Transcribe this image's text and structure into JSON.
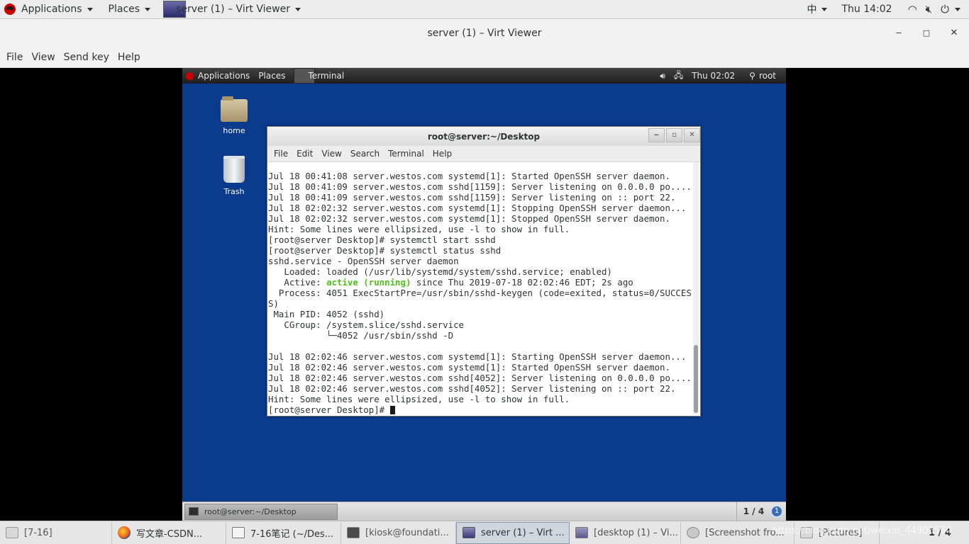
{
  "host_topbar": {
    "applications": "Applications",
    "places": "Places",
    "window_title": "server (1) – Virt Viewer",
    "input_method": "中",
    "clock": "Thu 14:02"
  },
  "viewer": {
    "title": "server (1) – Virt Viewer",
    "minimize": "‒",
    "maximize": "□",
    "close": "✕",
    "menu": [
      "File",
      "View",
      "Send key",
      "Help"
    ]
  },
  "guest": {
    "topbar": {
      "applications": "Applications",
      "places": "Places",
      "terminal": "Terminal",
      "clock": "Thu 02:02",
      "user": "root"
    },
    "desktop_icons": [
      "home",
      "Trash"
    ],
    "terminal": {
      "title": "root@server:~/Desktop",
      "menu": [
        "File",
        "Edit",
        "View",
        "Search",
        "Terminal",
        "Help"
      ],
      "lines": [
        "Jul 18 00:41:08 server.westos.com systemd[1]: Started OpenSSH server daemon.",
        "Jul 18 00:41:09 server.westos.com sshd[1159]: Server listening on 0.0.0.0 po....",
        "Jul 18 00:41:09 server.westos.com sshd[1159]: Server listening on :: port 22.",
        "Jul 18 02:02:32 server.westos.com systemd[1]: Stopping OpenSSH server daemon...",
        "Jul 18 02:02:32 server.westos.com systemd[1]: Stopped OpenSSH server daemon.",
        "Hint: Some lines were ellipsized, use -l to show in full.",
        "[root@server Desktop]# systemctl start sshd",
        "[root@server Desktop]# systemctl status sshd",
        "sshd.service - OpenSSH server daemon",
        "   Loaded: loaded (/usr/lib/systemd/system/sshd.service; enabled)",
        "   Active: ",
        "  Process: 4051 ExecStartPre=/usr/sbin/sshd-keygen (code=exited, status=0/SUCCES",
        "S)",
        " Main PID: 4052 (sshd)",
        "   CGroup: /system.slice/sshd.service",
        "           └─4052 /usr/sbin/sshd -D",
        "",
        "Jul 18 02:02:46 server.westos.com systemd[1]: Starting OpenSSH server daemon...",
        "Jul 18 02:02:46 server.westos.com systemd[1]: Started OpenSSH server daemon.",
        "Jul 18 02:02:46 server.westos.com sshd[4052]: Server listening on 0.0.0.0 po....",
        "Jul 18 02:02:46 server.westos.com sshd[4052]: Server listening on :: port 22.",
        "Hint: Some lines were ellipsized, use -l to show in full."
      ],
      "active_status": "active (running)",
      "active_rest": " since Thu 2019-07-18 02:02:46 EDT; 2s ago",
      "prompt": "[root@server Desktop]# "
    },
    "bottombar": {
      "task": "root@server:~/Desktop",
      "workspace": "1 / 4",
      "notifications": "1"
    }
  },
  "host_taskbar": {
    "tasks": [
      "[7-16]",
      "写文章-CSDN...",
      "7-16笔记 (~/Des...",
      "[kiosk@foundati...",
      "server (1) – Virt ...",
      "[desktop (1) – Vi...",
      "[Screenshot fro...",
      "[Pictures]"
    ],
    "workspace": "1 / 4",
    "watermark": "https://blog.csdn.net/weixin_44906564"
  },
  "colors": {
    "guest_desktop": "#0b3b8c",
    "active_green": "#4ec11a",
    "redhat_red": "#cc0000"
  }
}
